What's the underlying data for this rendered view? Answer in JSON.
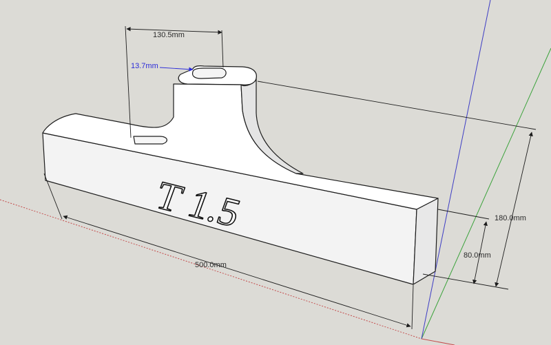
{
  "viewport": {
    "background": "#dcdbd6",
    "axis_colors": {
      "red": "#c44b4b",
      "green": "#3aa23a",
      "blue": "#3c3cc4"
    }
  },
  "model": {
    "engraved_text": "T 1.5",
    "face_color": "#ffffff",
    "edge_color": "#1c1c1c"
  },
  "dimensions": [
    {
      "id": "width",
      "text": "130.5mm"
    },
    {
      "id": "depth",
      "text": "13.7mm",
      "selected": true
    },
    {
      "id": "total-height",
      "text": "180.0mm"
    },
    {
      "id": "base-height",
      "text": "80.0mm"
    },
    {
      "id": "length",
      "text": "500.0mm"
    }
  ]
}
